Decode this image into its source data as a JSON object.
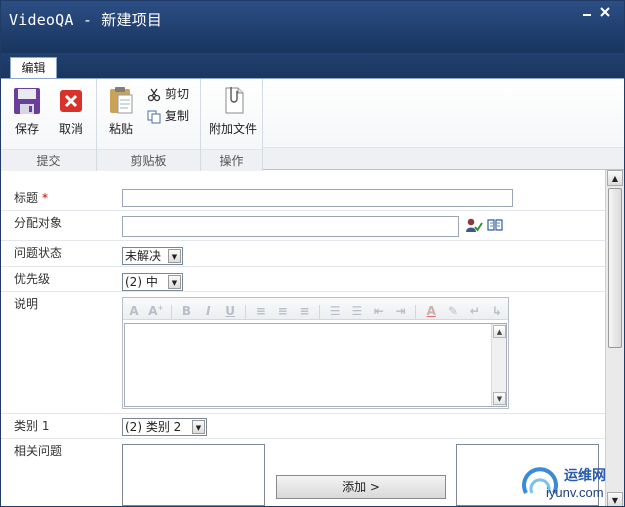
{
  "window": {
    "title": "VideoQA - 新建项目"
  },
  "tabs": [
    {
      "label": "编辑"
    }
  ],
  "ribbon": {
    "groups": [
      {
        "label": "提交",
        "buttons": [
          {
            "label": "保存"
          },
          {
            "label": "取消"
          }
        ]
      },
      {
        "label": "剪贴板",
        "buttons": [
          {
            "label": "粘贴"
          },
          {
            "label": "剪切"
          },
          {
            "label": "复制"
          }
        ]
      },
      {
        "label": "操作",
        "buttons": [
          {
            "label": "附加文件"
          }
        ]
      }
    ]
  },
  "form": {
    "title_field": {
      "label": "标题",
      "required_marker": "*",
      "value": ""
    },
    "assigned_to": {
      "label": "分配对象",
      "value": ""
    },
    "issue_status": {
      "label": "问题状态",
      "selected": "未解决"
    },
    "priority": {
      "label": "优先级",
      "selected": "(2) 中"
    },
    "description": {
      "label": "说明",
      "value": ""
    },
    "category": {
      "label": "类别 1",
      "selected": "(2) 类别 2"
    },
    "related_issues": {
      "label": "相关问题",
      "add_button": "添加 >"
    }
  },
  "watermark": {
    "text": "运维网",
    "url_text": "iyunv.com"
  },
  "colors": {
    "titlebar": "#1f3b66",
    "required": "#cc0000"
  }
}
